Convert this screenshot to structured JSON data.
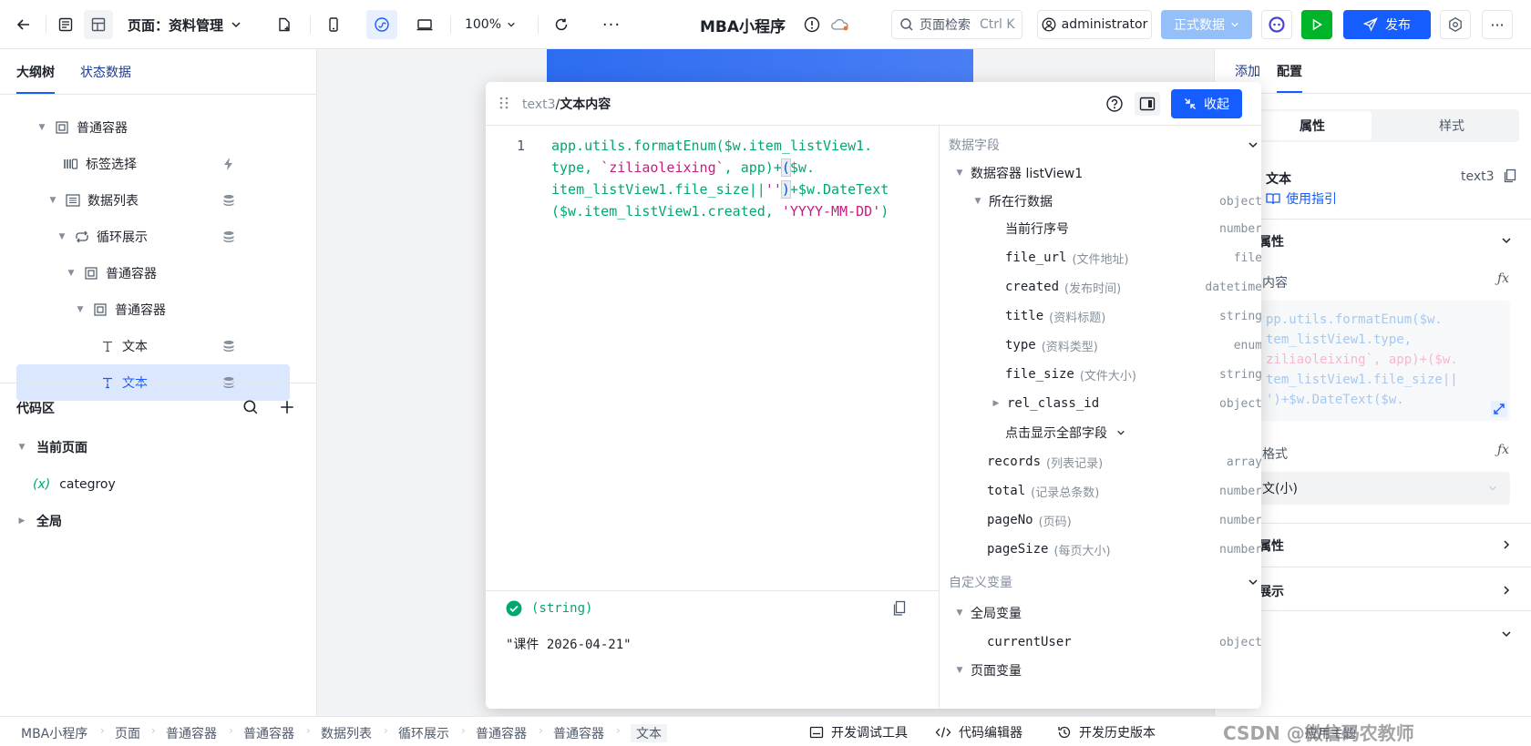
{
  "topbar": {
    "page_selector": "页面：资料管理",
    "zoom": "100%",
    "app_title": "MBA小程序",
    "search_placeholder": "页面检索",
    "search_shortcut": "Ctrl K",
    "user": "administrator",
    "data_mode": "正式数据",
    "publish": "发布"
  },
  "left": {
    "tabs": [
      "大纲树",
      "状态数据"
    ],
    "tree": [
      {
        "label": "普通容器"
      },
      {
        "label": "标签选择"
      },
      {
        "label": "数据列表"
      },
      {
        "label": "循环展示"
      },
      {
        "label": "普通容器"
      },
      {
        "label": "普通容器"
      },
      {
        "label": "文本"
      },
      {
        "label": "文本"
      }
    ],
    "code_area": {
      "title": "代码区",
      "current_page": "当前页面",
      "variable_symbol": "(x)",
      "variable": "categroy",
      "global": "全局"
    }
  },
  "modal": {
    "breadcrumb_component": "text3",
    "breadcrumb_sep": "/",
    "breadcrumb_field": "文本内容",
    "collapse": "收起",
    "line_number": "1",
    "code": {
      "l1a": "app.utils.formatEnum($w.item_listView1.",
      "l2a": "type, ",
      "l2b": "`ziliaoleixing`",
      "l2c": ", app)+",
      "l2d": "(",
      "l2e": "$w.",
      "l3a": "item_listView1.file_size||",
      "l3b": "''",
      "l3c": ")",
      "l3d": "+$w.DateText",
      "l4a": "($w.item_listView1.created, ",
      "l4b": "'YYYY-MM-DD'",
      "l4c": ")"
    },
    "result_type": "(string)",
    "result_value": "\"课件 2026-04-21\"",
    "fields_header": "数据字段",
    "container": "数据容器 listView1",
    "row_data": "所在行数据",
    "row_data_type": "object",
    "fields": [
      {
        "name": "当前行序号",
        "desc": "",
        "type": "number"
      },
      {
        "name": "file_url",
        "desc": "(文件地址)",
        "type": "file"
      },
      {
        "name": "created",
        "desc": "(发布时间)",
        "type": "datetime"
      },
      {
        "name": "title",
        "desc": "(资料标题)",
        "type": "string"
      },
      {
        "name": "type",
        "desc": "(资料类型)",
        "type": "enum"
      },
      {
        "name": "file_size",
        "desc": "(文件大小)",
        "type": "string"
      },
      {
        "name": "rel_class_id",
        "desc": "",
        "type": "object"
      }
    ],
    "show_all": "点击显示全部字段",
    "list_fields": [
      {
        "name": "records",
        "desc": "(列表记录)",
        "type": "array"
      },
      {
        "name": "total",
        "desc": "(记录总条数)",
        "type": "number"
      },
      {
        "name": "pageNo",
        "desc": "(页码)",
        "type": "number"
      },
      {
        "name": "pageSize",
        "desc": "(每页大小)",
        "type": "number"
      }
    ],
    "custom_vars": "自定义变量",
    "global_vars": "全局变量",
    "current_user": "currentUser",
    "current_user_type": "object",
    "page_vars": "页面变量"
  },
  "right": {
    "tabs": [
      "添加",
      "配置"
    ],
    "seg": [
      "属性",
      "样式"
    ],
    "component_name": "文本",
    "component_id": "text3",
    "guide": "使用指引",
    "section_props": "属性",
    "content_label": "内容",
    "content_preview": [
      "pp.utils.formatEnum($w.",
      "tem_listView1.type,",
      "ziliaoleixing`, app)+($w.",
      "tem_listView1.file_size||",
      "')+$w.DateText($w."
    ],
    "format_label": "格式",
    "format_value": "文(小)",
    "section_props2": "属性",
    "section_display": "展示",
    "theme": "应用主题"
  },
  "bottom": {
    "breadcrumbs": [
      "MBA小程序",
      "页面",
      "普通容器",
      "普通容器",
      "数据列表",
      "循环展示",
      "普通容器",
      "普通容器",
      "文本"
    ],
    "debug": "开发调试工具",
    "code_editor": "代码编辑器",
    "history": "开发历史版本",
    "watermark": "CSDN @微信码农教师"
  },
  "colors": {
    "primary": "#165dff",
    "green": "#00b42a",
    "code_blue": "#0a53be",
    "code_red": "#c41d7f"
  }
}
